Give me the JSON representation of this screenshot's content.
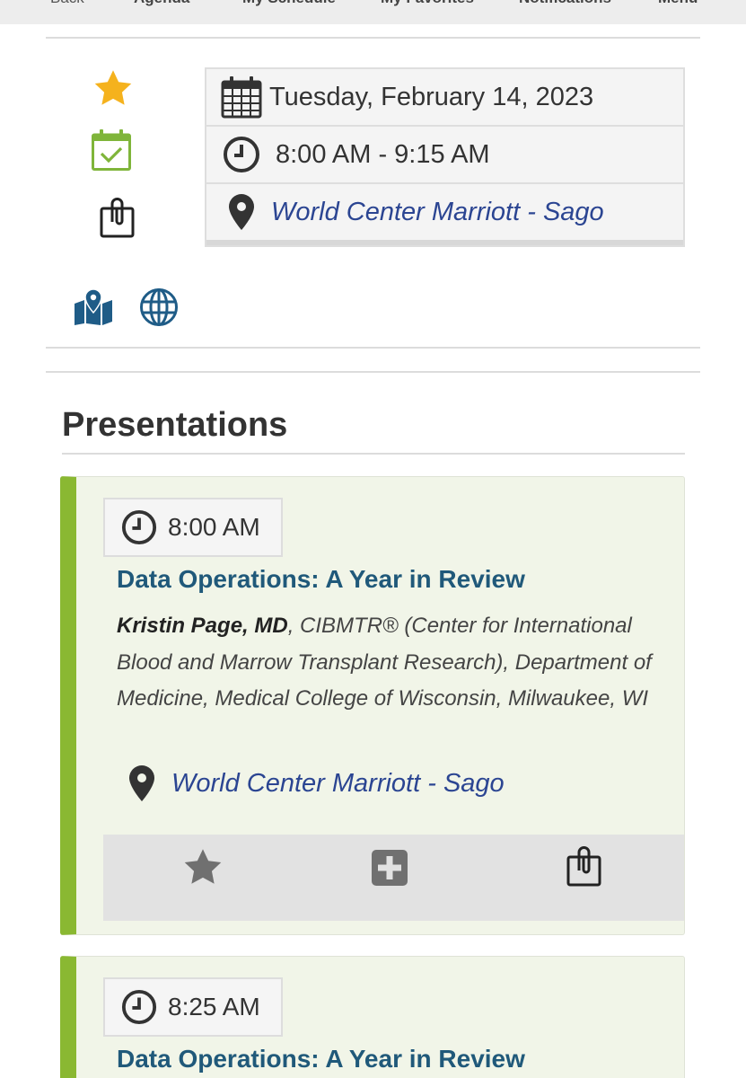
{
  "nav": {
    "back": "Back",
    "items": [
      "Agenda",
      "My Schedule",
      "My Favorites",
      "Notifications",
      "Menu"
    ]
  },
  "session": {
    "date": "Tuesday, February 14, 2023",
    "time": "8:00 AM - 9:15 AM",
    "location": "World Center Marriott - Sago",
    "icons": [
      "star-icon",
      "calendar-check-icon",
      "clipboard-icon",
      "map-icon",
      "globe-icon"
    ]
  },
  "presentations_heading": "Presentations",
  "presentations": [
    {
      "time": "8:00 AM",
      "title": "Data Operations: A Year in Review",
      "author": "Kristin Page, MD",
      "affiliation": ", CIBMTR® (Center for International Blood and Marrow Transplant Research), Department of Medicine, Medical College of Wisconsin, Milwaukee, WI",
      "location": "World Center Marriott - Sago"
    },
    {
      "time": "8:25 AM",
      "title": "Data Operations: A Year in Review"
    }
  ],
  "colors": {
    "accent_green": "#8ab832",
    "star_gold": "#f5b21d",
    "link_blue": "#2b4592",
    "title_teal": "#20597a",
    "icon_blue": "#1f5c87"
  }
}
